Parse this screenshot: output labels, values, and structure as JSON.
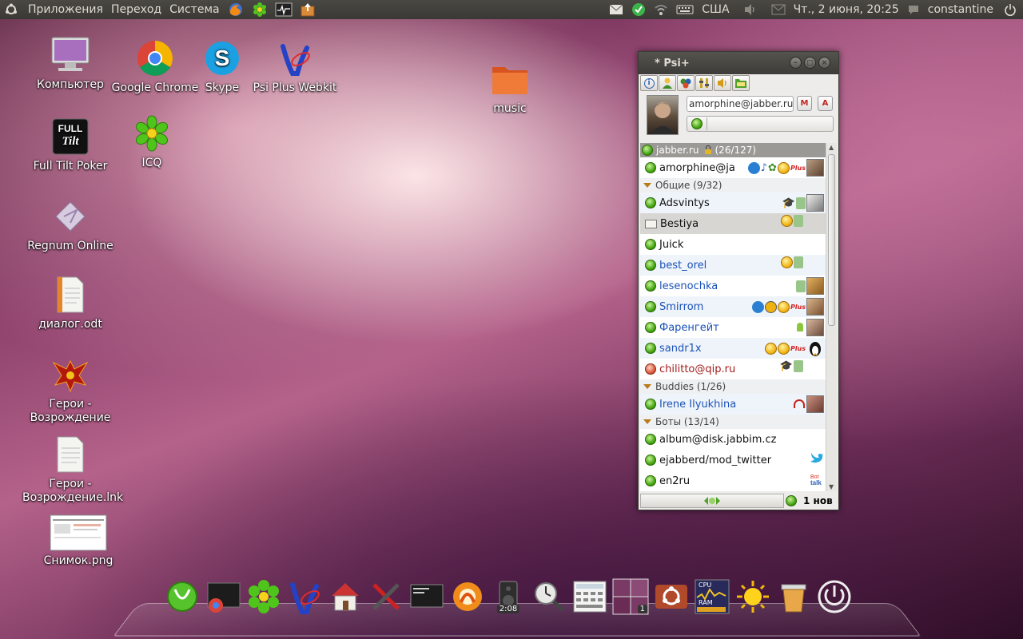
{
  "top_panel": {
    "menus": [
      "Приложения",
      "Переход",
      "Система"
    ],
    "launchers": [
      "firefox-icon",
      "icq-icon",
      "system-monitor-icon",
      "package-icon"
    ],
    "keyboard_layout": "США",
    "datetime": "Чт., 2 июня, 20:25",
    "user": "constantine"
  },
  "desktop_icons": [
    {
      "label": "Компьютер",
      "icon": "computer-icon"
    },
    {
      "label": "Google Chrome",
      "icon": "chrome-icon"
    },
    {
      "label": "Skype",
      "icon": "skype-icon"
    },
    {
      "label": "Psi Plus Webkit",
      "icon": "psi-plus-icon"
    },
    {
      "label": "music",
      "icon": "folder-icon"
    },
    {
      "label": "Full Tilt Poker",
      "icon": "poker-icon"
    },
    {
      "label": "ICQ",
      "icon": "icq-icon"
    },
    {
      "label": "Regnum Online",
      "icon": "regnum-icon"
    },
    {
      "label": "диалог.odt",
      "icon": "document-icon"
    },
    {
      "label": "Герои - Возрождение",
      "icon": "heroes-icon"
    },
    {
      "label": "Герои - Возрождение.lnk",
      "icon": "text-file-icon"
    },
    {
      "label": "Снимок.png",
      "icon": "image-icon"
    }
  ],
  "psi": {
    "title": "* Psi+",
    "account_jid": "amorphine@jabber.ru",
    "roster": {
      "account": {
        "name": "jabber.ru",
        "count": "(26/127)"
      },
      "self": "amorphine@ja",
      "groups": [
        {
          "name": "Общие (9/32)",
          "contacts": [
            {
              "name": "Adsvintys",
              "color": "black"
            },
            {
              "name": "Bestiya",
              "color": "black"
            },
            {
              "name": "Juick",
              "color": "black"
            },
            {
              "name": "best_orel",
              "color": "blue"
            },
            {
              "name": "lesenochka",
              "color": "blue"
            },
            {
              "name": "Smirrom",
              "color": "blue"
            },
            {
              "name": "Фаренгейт",
              "color": "blue"
            },
            {
              "name": "sandr1x",
              "color": "blue"
            },
            {
              "name": "chilitto@qip.ru",
              "color": "red"
            }
          ]
        },
        {
          "name": "Buddies (1/26)",
          "contacts": [
            {
              "name": "Irene Ilyukhina",
              "color": "blue"
            }
          ]
        },
        {
          "name": "Боты (13/14)",
          "contacts": [
            {
              "name": "album@disk.jabbim.cz",
              "color": "black"
            },
            {
              "name": "ejabberd/mod_twitter",
              "color": "black"
            },
            {
              "name": "en2ru",
              "color": "black"
            }
          ]
        }
      ]
    },
    "new_events": "1 нов"
  },
  "dock": {
    "items": [
      "psi-icon",
      "terminal-chrome-icon",
      "icq-icon",
      "psi-plus-icon",
      "home-icon",
      "tools-icon",
      "terminal-icon",
      "firefox-alt-icon",
      "speaker-icon",
      "clock-search-icon",
      "calculator-icon",
      "workspace-switcher-icon",
      "ubuntu-icon",
      "cpu-monitor-icon",
      "weather-icon",
      "trash-icon",
      "power-icon"
    ],
    "speaker_time": "2:08",
    "workspace_number": "1",
    "cpu_label": "CPU",
    "ram_label": "RAM"
  },
  "colors": {
    "panel": "#3c3b37",
    "online": "#3ea10a",
    "link_blue": "#1a52b8"
  }
}
